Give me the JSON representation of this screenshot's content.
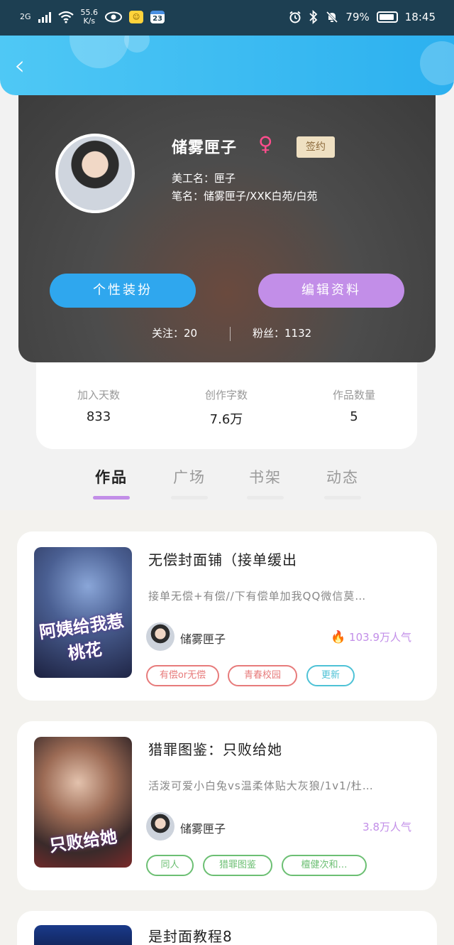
{
  "status_bar": {
    "network_type": "2G",
    "speed": "55.6",
    "speed_unit": "K/s",
    "calendar_day": "23",
    "battery": "79%",
    "time": "18:45"
  },
  "header": {
    "back_icon": "chevron-left-icon"
  },
  "profile": {
    "name": "储雾匣子",
    "gender_symbol": "♀",
    "badge": "签约",
    "artist_name": "美工名：匣子",
    "signature": "笔名：储雾匣子/XXK白苑/白苑",
    "dress_button": "个性装扮",
    "edit_button": "编辑资料",
    "follow_label": "关注：20",
    "fans_label": "粉丝：1132"
  },
  "stats": [
    {
      "label": "加入天数",
      "value": "833"
    },
    {
      "label": "创作字数",
      "value": "7.6万"
    },
    {
      "label": "作品数量",
      "value": "5"
    }
  ],
  "tabs": [
    {
      "label": "作品",
      "active": true
    },
    {
      "label": "广场",
      "active": false
    },
    {
      "label": "书架",
      "active": false
    },
    {
      "label": "动态",
      "active": false
    }
  ],
  "works": [
    {
      "title": "无偿封面铺（接单缓出",
      "cover_text": "阿姨给我惹桃花",
      "description": "接单无偿+有偿//下有偿单加我QQ微信莫…",
      "author": "储雾匣子",
      "heat": "103.9万人气",
      "heat_color": "#c28ee8",
      "tags": [
        {
          "label": "有偿or无偿",
          "color": "#e77b7b"
        },
        {
          "label": "青春校园",
          "color": "#e77b7b"
        },
        {
          "label": "更新",
          "color": "#4ec2d6"
        }
      ]
    },
    {
      "title": "猎罪图鉴：只败给她",
      "cover_text": "只败给她",
      "description": "活泼可爱小白兔vs温柔体贴大灰狼/1v1/杜…",
      "author": "储雾匣子",
      "heat": "3.8万人气",
      "heat_color": "#c28ee8",
      "tags": [
        {
          "label": "同人",
          "color": "#6cbf73"
        },
        {
          "label": "猎罪图鉴",
          "color": "#6cbf73"
        },
        {
          "label": "檀健次和…",
          "color": "#6cbf73"
        }
      ]
    },
    {
      "title": "是封面教程8"
    }
  ]
}
